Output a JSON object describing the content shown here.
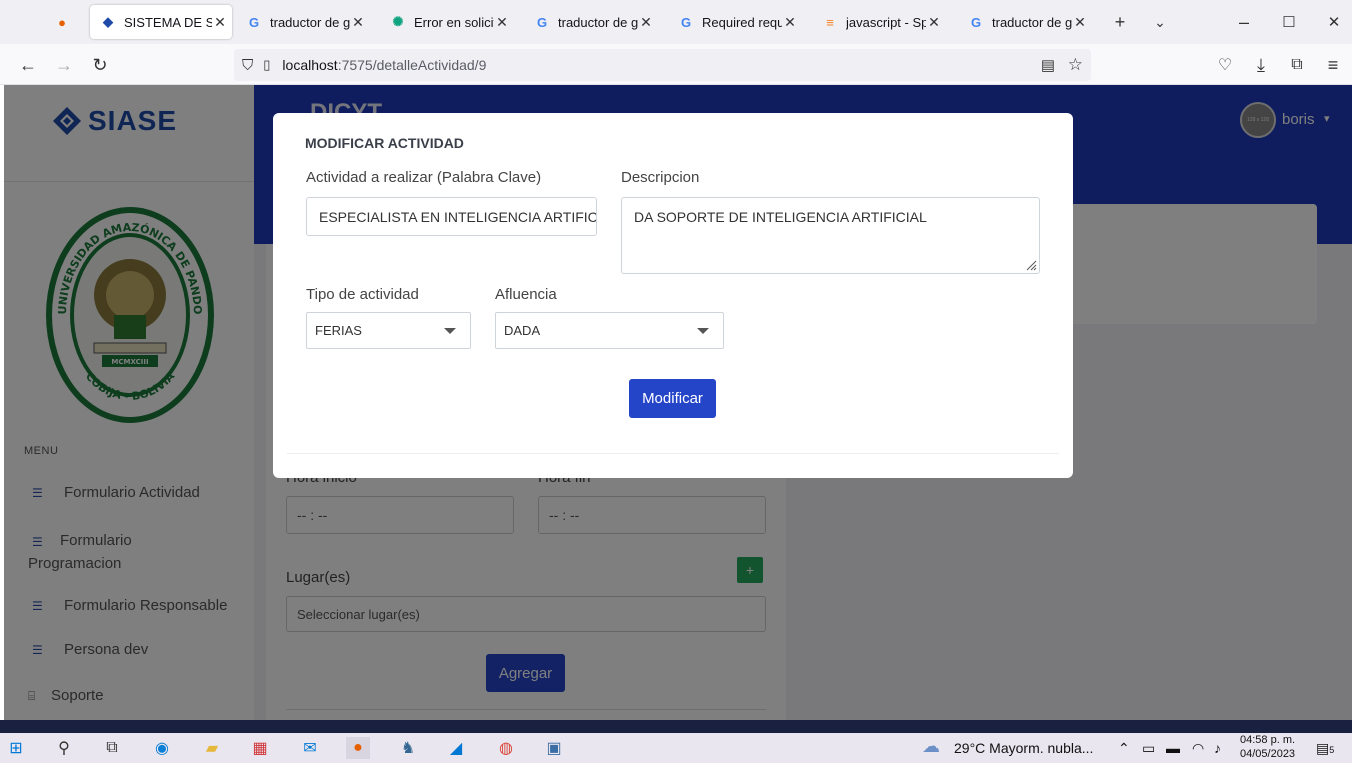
{
  "browser": {
    "tabs": [
      {
        "title": "",
        "icon": "firefox-icon"
      },
      {
        "title": "SISTEMA DE SEG",
        "icon": "siase-favicon",
        "active": true
      },
      {
        "title": "traductor de goo",
        "icon": "google-icon"
      },
      {
        "title": "Error en solicitud",
        "icon": "openai-icon"
      },
      {
        "title": "traductor de goo",
        "icon": "google-icon"
      },
      {
        "title": "Required request",
        "icon": "google-icon"
      },
      {
        "title": "javascript - Sprin",
        "icon": "stackoverflow-icon"
      },
      {
        "title": "traductor de goo",
        "icon": "google-icon"
      }
    ],
    "url_host": "localhost",
    "url_path": ":7575/detalleActividad/9"
  },
  "sidebar": {
    "brand": "SIASE",
    "seal": {
      "name": "UNIVERSIDAD AMAZÓNICA DE PANDO",
      "year": "MCMXCIII",
      "city": "COBIJA - BOLIVIA"
    },
    "menu_title": "MENU",
    "items": [
      {
        "label": "Formulario Actividad"
      },
      {
        "label": "Formulario Programacion"
      },
      {
        "label": "Formulario Responsable"
      },
      {
        "label": "Persona dev"
      },
      {
        "label": "Soporte"
      }
    ]
  },
  "header": {
    "app_title": "DICYT",
    "avatar_text": "128 x 128",
    "username": "boris"
  },
  "background_form": {
    "hora_inicio_label": "Hora inicio",
    "hora_fin_label": "Hora fin",
    "time_placeholder": "-- : --",
    "lugar_label": "Lugar(es)",
    "lugar_placeholder": "Seleccionar lugar(es)",
    "add_label": "Agregar"
  },
  "modal": {
    "title": "MODIFICAR ACTIVIDAD",
    "actividad_label": "Actividad a realizar (Palabra Clave)",
    "actividad_value": "ESPECIALISTA EN INTELIGENCIA ARTIFICIAL",
    "descripcion_label": "Descripcion",
    "descripcion_value": "DA SOPORTE DE INTELIGENCIA ARTIFICIAL",
    "tipo_label": "Tipo de actividad",
    "tipo_value": "FERIAS",
    "afluencia_label": "Afluencia",
    "afluencia_value": "DADA",
    "submit_label": "Modificar"
  },
  "taskbar": {
    "weather": "29°C  Mayorm. nubla...",
    "time": "04:58 p. m.",
    "date": "04/05/2023",
    "notifications": "5"
  }
}
